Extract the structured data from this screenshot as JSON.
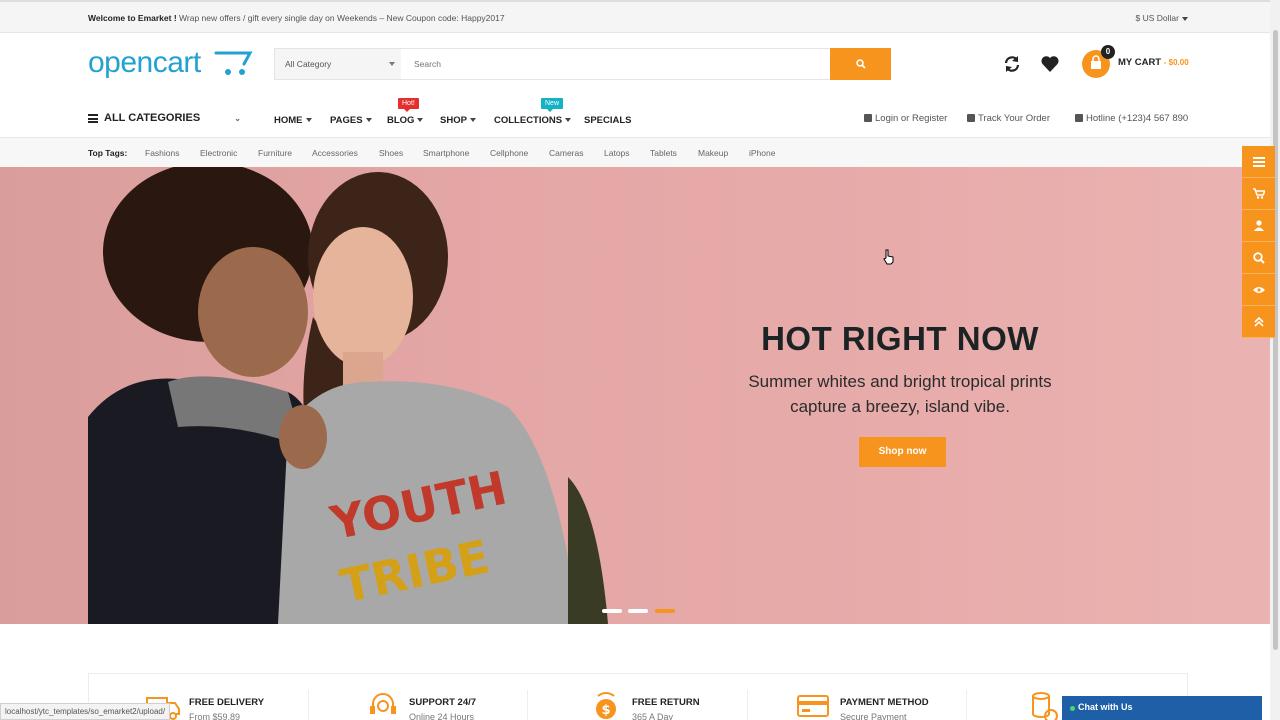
{
  "topbar": {
    "welcome_bold": "Welcome to Emarket !",
    "welcome_text": "Wrap new offers / gift every single day on Weekends – New Coupon code: Happy2017",
    "currency": "$ US Dollar"
  },
  "header": {
    "logo": "opencart",
    "search": {
      "category": "All Category",
      "placeholder": "Search"
    },
    "cart": {
      "count": "0",
      "label": "MY CART",
      "amount": "- $0.00"
    }
  },
  "nav": {
    "all_categories": "ALL CATEGORIES",
    "items": [
      "HOME",
      "PAGES",
      "BLOG",
      "SHOP",
      "COLLECTIONS",
      "SPECIALS"
    ],
    "badges": {
      "blog": "Hot!",
      "collections": "New"
    },
    "login": "Login or Register",
    "track": "Track Your Order",
    "hotline": "Hotline (+123)4 567 890"
  },
  "tags": {
    "title": "Top Tags:",
    "items": [
      "Fashions",
      "Electronic",
      "Furniture",
      "Accessories",
      "Shoes",
      "Smartphone",
      "Cellphone",
      "Cameras",
      "Latops",
      "Tablets",
      "Makeup",
      "iPhone"
    ]
  },
  "hero": {
    "title": "HOT RIGHT NOW",
    "subtitle_line1": "Summer whites and bright tropical prints",
    "subtitle_line2": "capture a breezy, island vibe.",
    "button": "Shop now",
    "slides": 3,
    "active_slide": 3
  },
  "services": [
    {
      "title": "FREE DELIVERY",
      "subtitle": "From $59.89"
    },
    {
      "title": "SUPPORT 24/7",
      "subtitle": "Online 24 Hours"
    },
    {
      "title": "FREE RETURN",
      "subtitle": "365 A Day"
    },
    {
      "title": "PAYMENT METHOD",
      "subtitle": "Secure Payment"
    }
  ],
  "statusbar": "localhost/ytc_templates/so_emarket2/upload/",
  "chat": "Chat with Us",
  "colors": {
    "accent": "#f7941d",
    "logo": "#23a1d1",
    "hot": "#e2302f",
    "new": "#13b2c5",
    "chat": "#1e5fa8"
  }
}
